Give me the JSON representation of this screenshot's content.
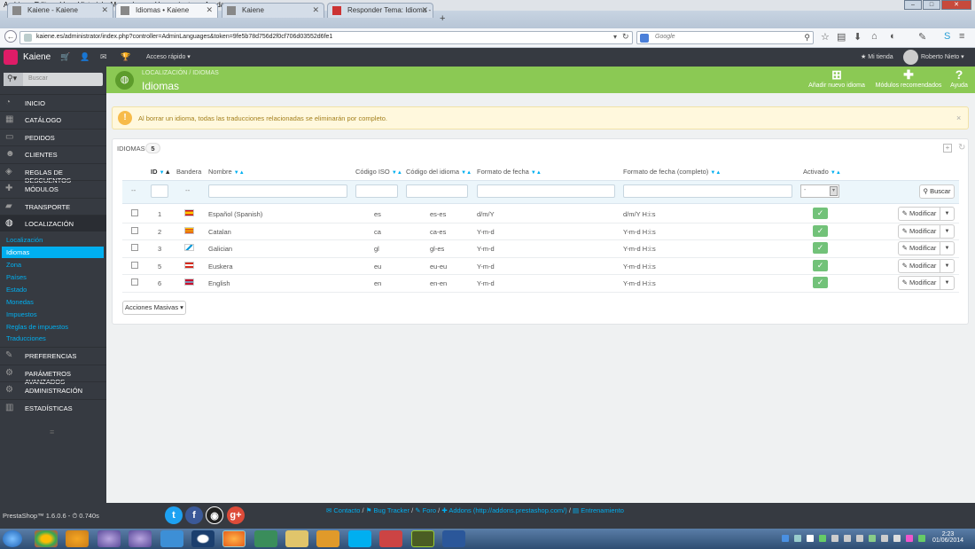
{
  "browser": {
    "menu": [
      "Archivo",
      "Editar",
      "Ver",
      "Historial",
      "Marcadores",
      "Herramientas",
      "Ayuda"
    ],
    "tabs": [
      {
        "label": "Kaiene - Kaiene"
      },
      {
        "label": "Idiomas • Kaiene"
      },
      {
        "label": "Kaiene"
      },
      {
        "label": "Responder Tema: Idioma - ..."
      }
    ],
    "new_tab": "+",
    "url": "kaiene.es/administrator/index.php?controller=AdminLanguages&token=9fe5b78d756d2f0cf706d03552d6fe1",
    "search_engine_placeholder": "Google"
  },
  "ps_header": {
    "shop_name": "Kaiene",
    "quick_access": "Acceso rápido",
    "my_shop": "Mi tienda",
    "user": "Roberto Nieto"
  },
  "sidebar": {
    "search_placeholder": "Buscar",
    "items": [
      {
        "label": "INICIO",
        "icon": "dashboard-icon"
      },
      {
        "label": "CATÁLOGO",
        "icon": "book-icon"
      },
      {
        "label": "PEDIDOS",
        "icon": "credit-card-icon"
      },
      {
        "label": "CLIENTES",
        "icon": "users-icon"
      },
      {
        "label": "REGLAS DE DESCUENTOS",
        "icon": "tag-icon"
      },
      {
        "label": "MÓDULOS",
        "icon": "puzzle-icon"
      },
      {
        "label": "TRANSPORTE",
        "icon": "truck-icon"
      },
      {
        "label": "LOCALIZACIÓN",
        "icon": "globe-icon"
      }
    ],
    "subitems": [
      {
        "label": "Localización"
      },
      {
        "label": "Idiomas"
      },
      {
        "label": "Zona"
      },
      {
        "label": "Países"
      },
      {
        "label": "Estado"
      },
      {
        "label": "Monedas"
      },
      {
        "label": "Impuestos"
      },
      {
        "label": "Reglas de impuestos"
      },
      {
        "label": "Traducciones"
      }
    ],
    "items_bottom": [
      {
        "label": "PREFERENCIAS",
        "icon": "wrench-icon"
      },
      {
        "label": "PARÁMETROS AVANZADOS",
        "icon": "cogs-icon"
      },
      {
        "label": "ADMINISTRACIÓN",
        "icon": "cog-icon"
      },
      {
        "label": "ESTADÍSTICAS",
        "icon": "bar-chart-icon"
      }
    ],
    "version": "PrestaShop™ 1.6.0.6 - ⏱ 0.740s"
  },
  "page": {
    "breadcrumb": [
      "LOCALIZACIÓN",
      "/",
      "IDIOMAS"
    ],
    "title": "Idiomas",
    "toolbar": [
      {
        "label": "Añadir nuevo idioma",
        "icon": "plus-icon"
      },
      {
        "label": "Módulos recomendados",
        "icon": "puzzle-icon"
      },
      {
        "label": "Ayuda",
        "icon": "help-icon"
      }
    ]
  },
  "alert": {
    "text": "Al borrar un idioma, todas las traducciones relacionadas se eliminarán por completo.",
    "close": "×"
  },
  "panel": {
    "title": "IDIOMAS",
    "count": "5",
    "columns": [
      "ID",
      "Bandera",
      "Nombre",
      "Código ISO",
      "Código del idioma",
      "Formato de fecha",
      "Formato de fecha (completo)",
      "Activado"
    ],
    "filter_dash": "--",
    "filter_active_value": "-",
    "search_button": "Buscar",
    "rows": [
      {
        "id": "1",
        "name": "Español (Spanish)",
        "iso": "es",
        "code": "es-es",
        "date": "d/m/Y",
        "date_full": "d/m/Y H:i:s",
        "flag": "es"
      },
      {
        "id": "2",
        "name": "Catalan",
        "iso": "ca",
        "code": "ca-es",
        "date": "Y-m-d",
        "date_full": "Y-m-d H:i:s",
        "flag": "ca"
      },
      {
        "id": "3",
        "name": "Galician",
        "iso": "gl",
        "code": "gl-es",
        "date": "Y-m-d",
        "date_full": "Y-m-d H:i:s",
        "flag": "gl"
      },
      {
        "id": "5",
        "name": "Euskera",
        "iso": "eu",
        "code": "eu-eu",
        "date": "Y-m-d",
        "date_full": "Y-m-d H:i:s",
        "flag": "eu"
      },
      {
        "id": "6",
        "name": "English",
        "iso": "en",
        "code": "en-en",
        "date": "Y-m-d",
        "date_full": "Y-m-d H:i:s",
        "flag": "en"
      }
    ],
    "edit_label": "Modificar",
    "bulk_label": "Acciones Masivas"
  },
  "footer": {
    "links": [
      "Contacto",
      "/",
      "Bug Tracker",
      "/",
      "Foro",
      "/",
      "Addons (http://addons.prestashop.com/)",
      "/",
      "Entrenamiento"
    ],
    "social": [
      "twitter-icon",
      "facebook-icon",
      "github-icon",
      "google-plus-icon"
    ]
  },
  "taskbar": {
    "time": "2:23",
    "date": "01/06/2014"
  },
  "colors": {
    "sidebar_bg": "#363a41",
    "header_green": "#8bc954",
    "accent_blue": "#00aff0",
    "success_green": "#72c279"
  }
}
